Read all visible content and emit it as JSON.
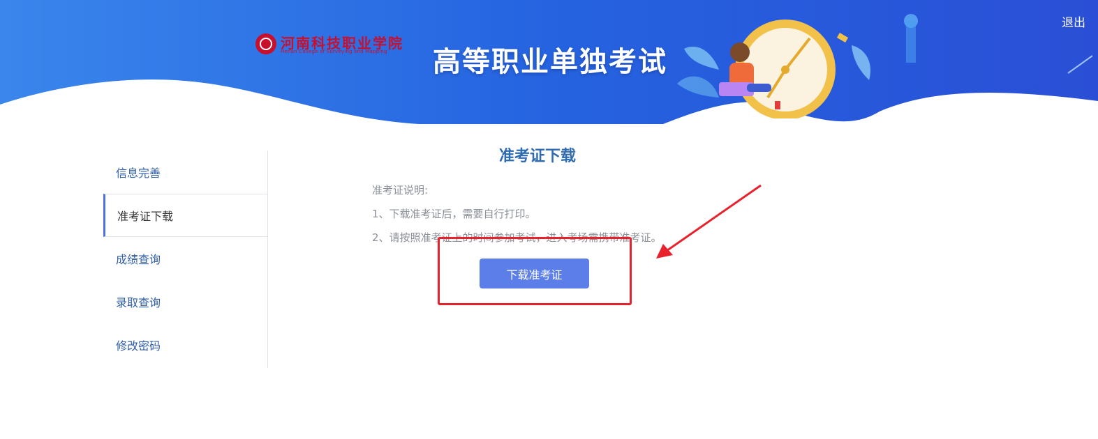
{
  "header": {
    "logo_cn": "河南科技职业学院",
    "logo_en": "Henan College of Surveying and Mapping",
    "title": "高等职业单独考试",
    "logout_label": "退出"
  },
  "sidebar": {
    "items": [
      {
        "label": "信息完善",
        "active": false
      },
      {
        "label": "准考证下载",
        "active": true
      },
      {
        "label": "成绩查询",
        "active": false
      },
      {
        "label": "录取查询",
        "active": false
      },
      {
        "label": "修改密码",
        "active": false
      }
    ]
  },
  "main": {
    "title": "准考证下载",
    "description": {
      "heading": "准考证说明:",
      "lines": [
        "1、下载准考证后，需要自行打印。",
        "2、请按照准考证上的时间参加考试，进入考场需携带准考证。"
      ]
    },
    "download_button": "下载准考证"
  },
  "colors": {
    "banner_blue": "#2f6be3",
    "accent": "#5b7ee8",
    "annotation_red": "#e8222c",
    "nav_text": "#2f5ea8",
    "title_blue": "#2e6bb0"
  }
}
